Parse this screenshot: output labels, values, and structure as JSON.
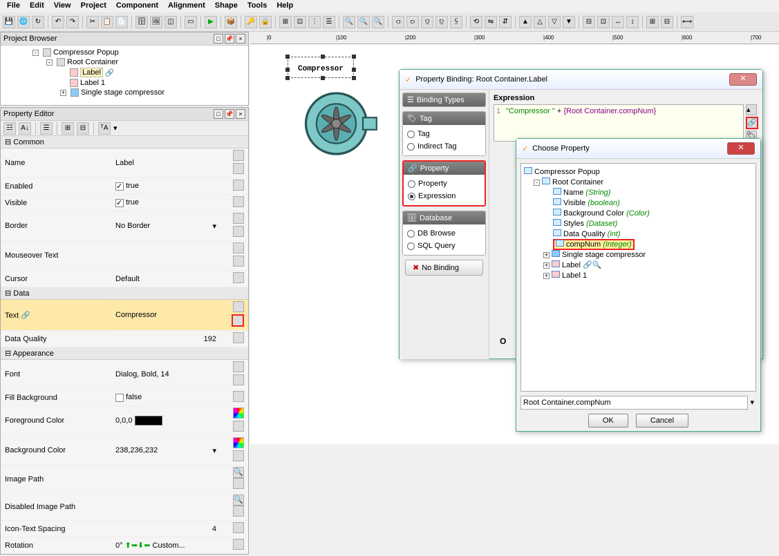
{
  "menu": [
    "File",
    "Edit",
    "View",
    "Project",
    "Component",
    "Alignment",
    "Shape",
    "Tools",
    "Help"
  ],
  "panels": {
    "project_browser": {
      "title": "Project Browser",
      "items": [
        {
          "label": "Compressor Popup",
          "indent": 40
        },
        {
          "label": "Root Container",
          "indent": 60
        },
        {
          "label": "Label",
          "indent": 80,
          "selected": true
        },
        {
          "label": "Label 1",
          "indent": 80
        },
        {
          "label": "Single stage compressor",
          "indent": 80,
          "expandable": true
        }
      ]
    },
    "property_editor": {
      "title": "Property Editor",
      "sections": {
        "common": {
          "title": "Common",
          "rows": [
            {
              "name": "Name",
              "value": "Label"
            },
            {
              "name": "Enabled",
              "value": "true",
              "check": true
            },
            {
              "name": "Visible",
              "value": "true",
              "check": true
            },
            {
              "name": "Border",
              "value": "No Border",
              "combo": true
            },
            {
              "name": "Mouseover Text",
              "value": ""
            },
            {
              "name": "Cursor",
              "value": "Default"
            }
          ]
        },
        "data": {
          "title": "Data",
          "rows": [
            {
              "name": "Text",
              "value": "Compressor",
              "highlight": true
            },
            {
              "name": "Data Quality",
              "value": "192"
            }
          ]
        },
        "appearance": {
          "title": "Appearance",
          "rows": [
            {
              "name": "Font",
              "value": "Dialog, Bold, 14"
            },
            {
              "name": "Fill Background",
              "value": "false",
              "check": false
            },
            {
              "name": "Foreground Color",
              "value": "0,0,0",
              "swatch": "#000"
            },
            {
              "name": "Background Color",
              "value": "238,236,232",
              "swatch": "#eeece8"
            },
            {
              "name": "Image Path",
              "value": ""
            },
            {
              "name": "Disabled Image Path",
              "value": ""
            },
            {
              "name": "Icon-Text Spacing",
              "value": "4"
            },
            {
              "name": "Rotation",
              "value": "0°",
              "custom": "Custom..."
            }
          ]
        }
      }
    }
  },
  "canvas": {
    "label_text": "Compressor",
    "ruler_marks": [
      "0",
      "100",
      "200",
      "300",
      "400",
      "500",
      "600",
      "700"
    ]
  },
  "binding_dialog": {
    "title": "Property Binding: Root Container.Label",
    "sidebar_title": "Binding Types",
    "groups": {
      "tag": {
        "title": "Tag",
        "options": [
          "Tag",
          "Indirect Tag"
        ]
      },
      "property": {
        "title": "Property",
        "options": [
          "Property",
          "Expression"
        ],
        "selected": "Expression",
        "highlight": true
      },
      "database": {
        "title": "Database",
        "options": [
          "DB Browse",
          "SQL Query"
        ]
      }
    },
    "no_binding": "No Binding",
    "expression_label": "Expression",
    "expression_line": "1",
    "expression_str": "\"Compressor \"",
    "expression_plus": " + ",
    "expression_ref": "{Root Container.compNum}"
  },
  "choose_dialog": {
    "title": "Choose Property",
    "tree": [
      {
        "label": "Compressor Popup",
        "indent": 0
      },
      {
        "label": "Root Container",
        "indent": 14,
        "exp": "-"
      },
      {
        "label": "Name",
        "type": "(String)",
        "indent": 42
      },
      {
        "label": "Visible",
        "type": "(boolean)",
        "indent": 42
      },
      {
        "label": "Background Color",
        "type": "(Color)",
        "indent": 42
      },
      {
        "label": "Styles",
        "type": "(Dataset)",
        "indent": 42
      },
      {
        "label": "Data Quality",
        "type": "(int)",
        "indent": 42
      },
      {
        "label": "compNum",
        "type": "(Integer)",
        "indent": 42,
        "selected": true
      },
      {
        "label": "Single stage compressor",
        "indent": 28,
        "exp": "+"
      },
      {
        "label": "Label",
        "indent": 28,
        "exp": "+",
        "extra": true
      },
      {
        "label": "Label 1",
        "indent": 28,
        "exp": "+"
      }
    ],
    "path": "Root Container.compNum",
    "ok": "OK",
    "cancel": "Cancel"
  }
}
